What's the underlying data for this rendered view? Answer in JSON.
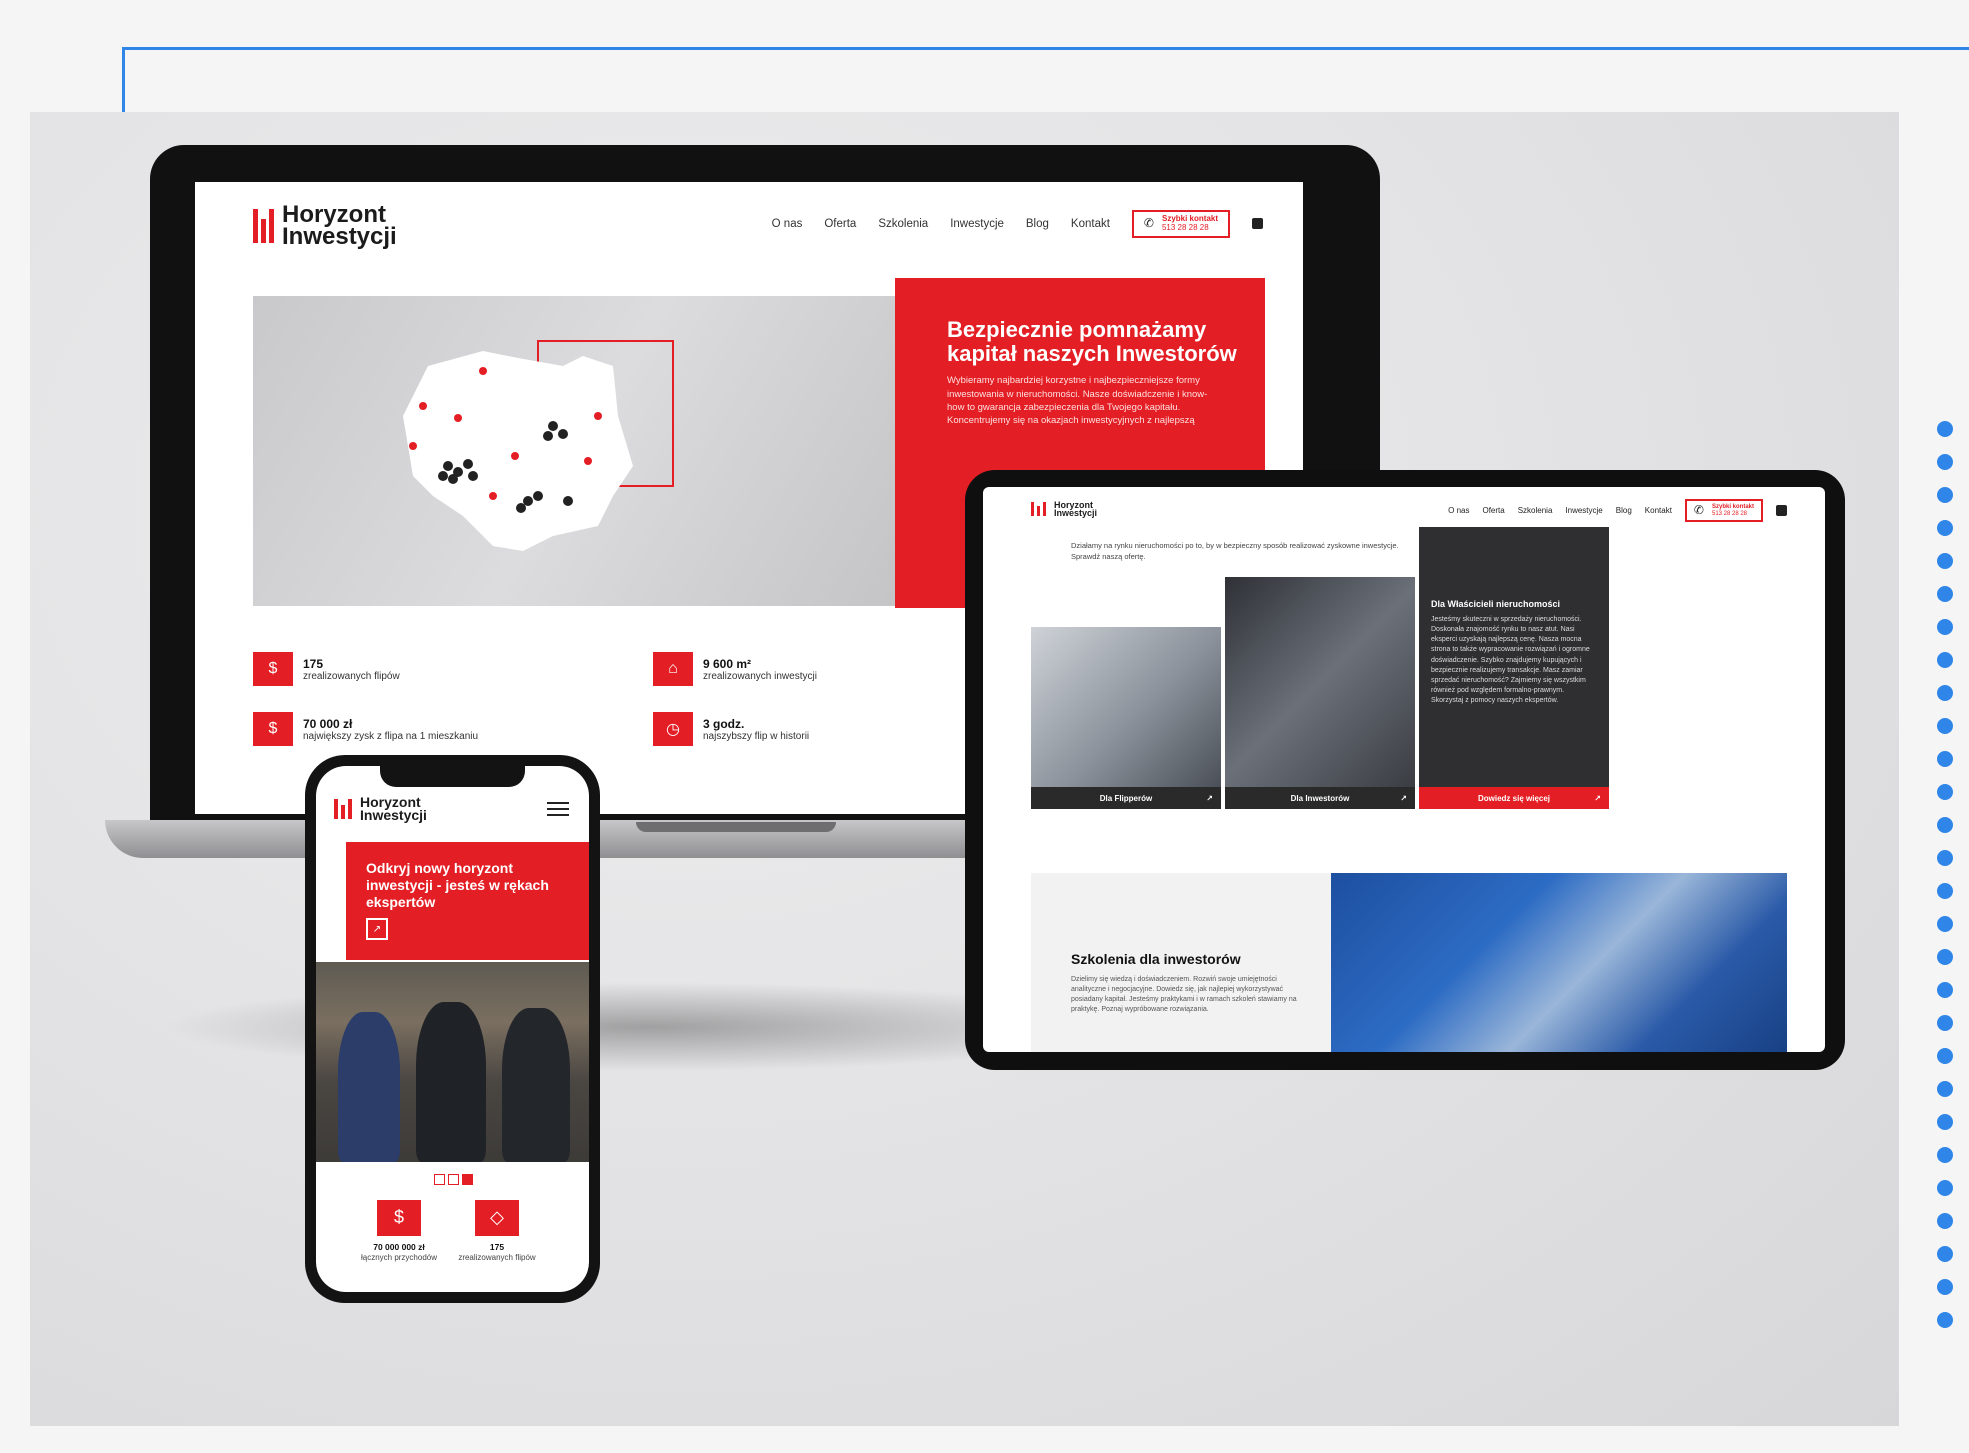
{
  "brand": {
    "line1": "Horyzont",
    "line2": "Inwestycji",
    "red": "#e31e24",
    "accent_blue": "#2f86e8"
  },
  "nav": {
    "items": [
      "O nas",
      "Oferta",
      "Szkolenia",
      "Inwestycje",
      "Blog",
      "Kontakt"
    ],
    "quick_label": "Szybki kontakt",
    "quick_phone": "513 28 28 28",
    "social_icon": "facebook-icon"
  },
  "laptop": {
    "hero_title": "Bezpiecznie pomnażamy kapitał naszych Inwestorów",
    "hero_text": "Wybieramy najbardziej korzystne i najbezpieczniejsze formy inwestowania w nieruchomości. Nasze doświadczenie i know-how to gwarancja zabezpieczenia dla Twojego kapitału. Koncentrujemy się na okazjach inwestycyjnych z najlepszą",
    "stats": [
      {
        "value": "175",
        "label": "zrealizowanych flipów"
      },
      {
        "value": "9 600 m²",
        "label": "zrealizowanych inwestycji"
      },
      {
        "value": "70 000 zł",
        "label": "największy zysk z flipa na 1 mieszkaniu"
      },
      {
        "value": "3 godz.",
        "label": "najszybszy flip w historii"
      }
    ]
  },
  "tablet": {
    "intro": "Działamy na rynku nieruchomości po to, by w bezpieczny sposób realizować zyskowne inwestycje. Sprawdź naszą ofertę.",
    "cards": [
      {
        "label": "Dla Flipperów"
      },
      {
        "label": "Dla Inwestorów"
      },
      {
        "label": "Dowiedz się więcej",
        "title": "Dla Właścicieli nieruchomości",
        "text": "Jesteśmy skuteczni w sprzedaży nieruchomości. Doskonała znajomość rynku to nasz atut. Nasi eksperci uzyskają najlepszą cenę. Nasza mocna strona to także wypracowanie rozwiązań i ogromne doświadczenie. Szybko znajdujemy kupujących i bezpiecznie realizujemy transakcje. Masz zamiar sprzedać nieruchomość? Zajmiemy się wszystkim również pod względem formalno-prawnym. Skorzystaj z pomocy naszych ekspertów."
      }
    ],
    "training_title": "Szkolenia dla inwestorów",
    "training_text": "Dzielimy się wiedzą i doświadczeniem. Rozwiń swoje umiejętności analityczne i negocjacyjne. Dowiedz się, jak najlepiej wykorzystywać posiadany kapitał. Jesteśmy praktykami i w ramach szkoleń stawiamy na praktykę. Poznaj wypróbowane rozwiązania."
  },
  "phone": {
    "hero_title": "Odkryj nowy horyzont inwestycji - jesteś w rękach ekspertów",
    "stats": [
      {
        "value": "70 000 000 zł",
        "label": "łącznych przychodów"
      },
      {
        "value": "175",
        "label": "zrealizowanych flipów"
      }
    ]
  }
}
